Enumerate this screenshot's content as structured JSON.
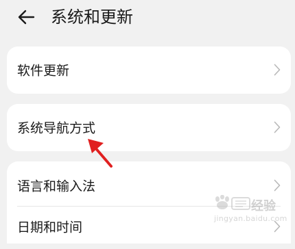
{
  "header": {
    "back_icon": "arrow-left-icon",
    "title": "系统和更新"
  },
  "cards": [
    {
      "rows": [
        {
          "label": "软件更新",
          "icon": "chevron-right-icon"
        }
      ]
    },
    {
      "rows": [
        {
          "label": "系统导航方式",
          "icon": "chevron-right-icon"
        }
      ]
    },
    {
      "rows": [
        {
          "label": "语言和输入法",
          "icon": "chevron-right-icon"
        },
        {
          "label": "日期和时间",
          "icon": "chevron-right-icon"
        }
      ]
    }
  ],
  "annotation": {
    "icon": "red-arrow-annotation",
    "color": "#e02020"
  },
  "watermark": {
    "logo": "baidu-jingyan-watermark",
    "text": "经验",
    "url": "jingyan.baidu.com"
  }
}
